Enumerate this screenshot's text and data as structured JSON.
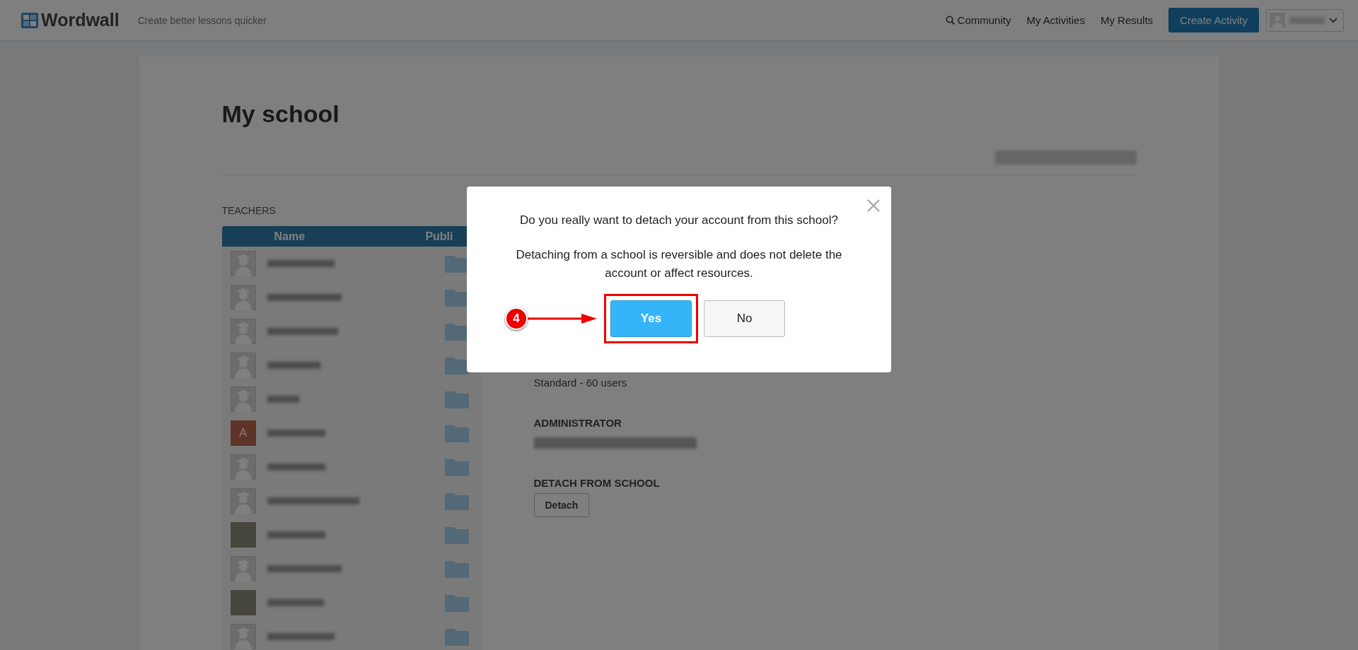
{
  "header": {
    "logo": "Wordwall",
    "tagline": "Create better lessons quicker",
    "nav": [
      {
        "label": "Community",
        "kind": "search"
      },
      {
        "label": "My Activities",
        "kind": "plain"
      },
      {
        "label": "My Results",
        "kind": "plain"
      }
    ],
    "create_button": "Create Activity"
  },
  "page": {
    "title": "My school",
    "teachers": {
      "heading": "TEACHERS",
      "columns": [
        "Name",
        "Publi"
      ],
      "rows": [
        {
          "kind": "default"
        },
        {
          "kind": "default"
        },
        {
          "kind": "default"
        },
        {
          "kind": "default"
        },
        {
          "kind": "default"
        },
        {
          "kind": "letter",
          "letter": "A"
        },
        {
          "kind": "default"
        },
        {
          "kind": "default"
        },
        {
          "kind": "photo"
        },
        {
          "kind": "default"
        },
        {
          "kind": "photo"
        },
        {
          "kind": "default"
        }
      ]
    },
    "plan": "Standard - 60 users",
    "administrator_heading": "ADMINISTRATOR",
    "detach_heading": "DETACH FROM SCHOOL",
    "detach_button": "Detach"
  },
  "dialog": {
    "question": "Do you really want to detach your account from this school?",
    "note": "Detaching from a school is reversible and does not delete the account or affect resources.",
    "buttons": [
      {
        "label": "Yes",
        "kind": "primary"
      },
      {
        "label": "No",
        "kind": "secondary"
      }
    ],
    "step_badge": "4"
  }
}
